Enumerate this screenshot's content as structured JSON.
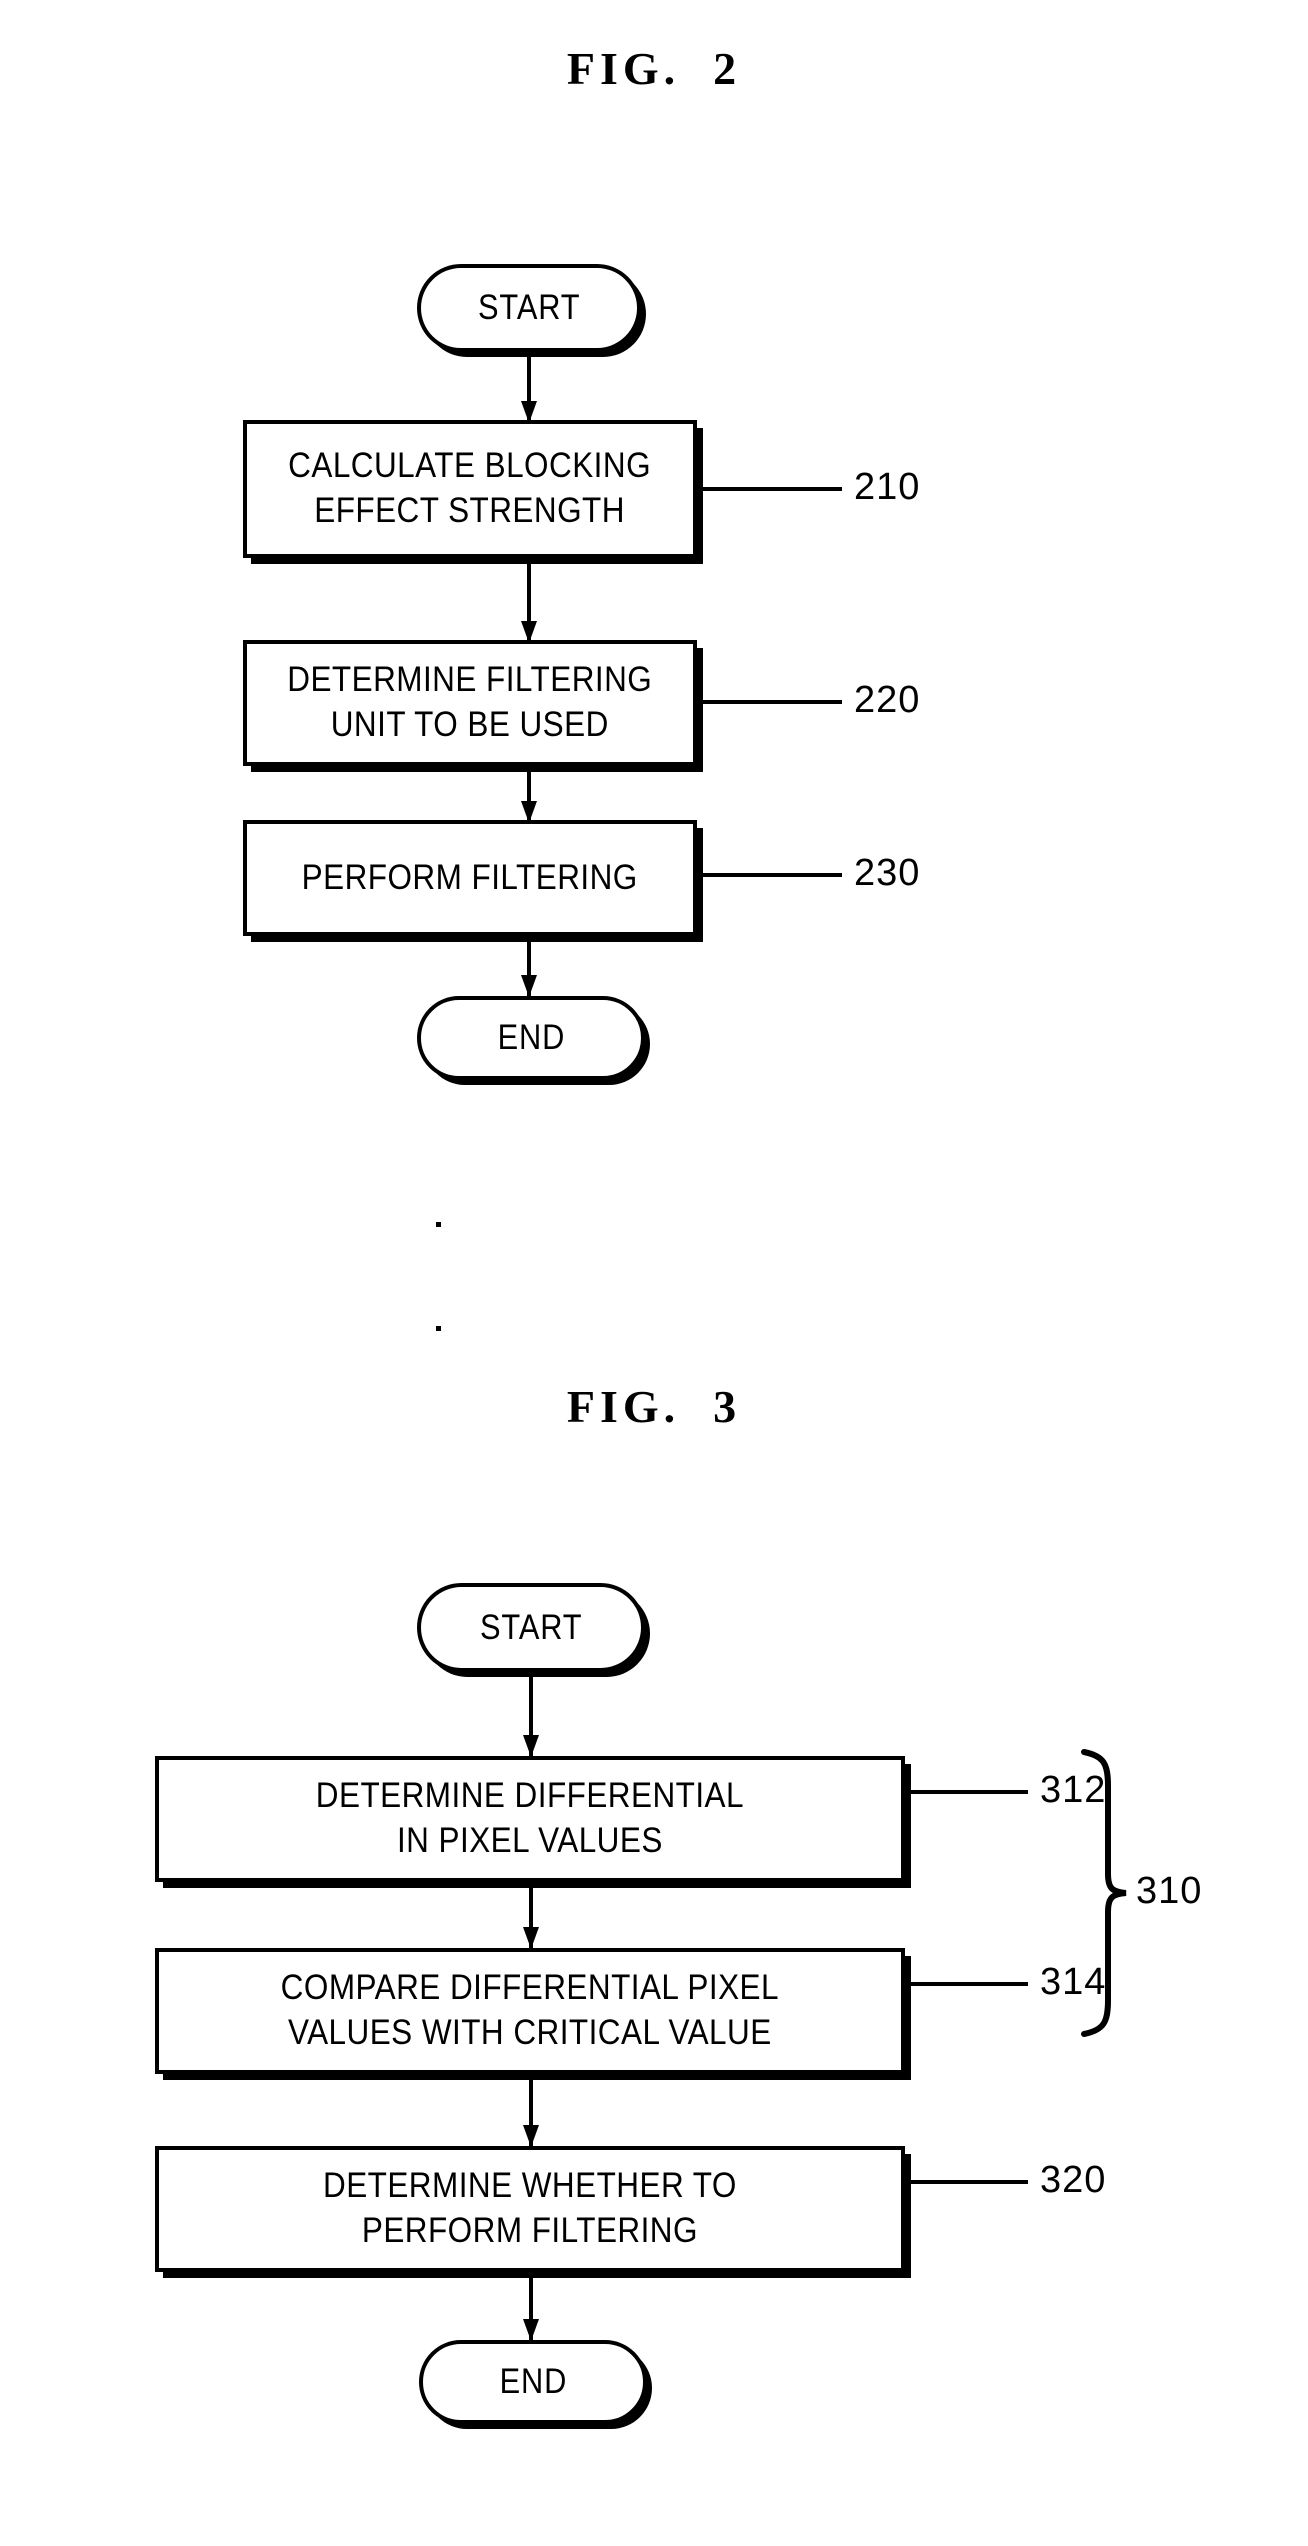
{
  "figures": [
    {
      "title": "FIG.  2",
      "start_label": "START",
      "end_label": "END",
      "steps": [
        {
          "text": "CALCULATE BLOCKING\nEFFECT STRENGTH",
          "ref": "210"
        },
        {
          "text": "DETERMINE FILTERING\nUNIT TO BE USED",
          "ref": "220"
        },
        {
          "text": "PERFORM FILTERING",
          "ref": "230"
        }
      ]
    },
    {
      "title": "FIG.  3",
      "start_label": "START",
      "end_label": "END",
      "group_ref": "310",
      "steps": [
        {
          "text": "DETERMINE DIFFERENTIAL\nIN PIXEL VALUES",
          "ref": "312"
        },
        {
          "text": "COMPARE DIFFERENTIAL PIXEL\nVALUES WITH CRITICAL VALUE",
          "ref": "314"
        },
        {
          "text": "DETERMINE WHETHER TO\nPERFORM FILTERING",
          "ref": "320"
        }
      ]
    }
  ]
}
